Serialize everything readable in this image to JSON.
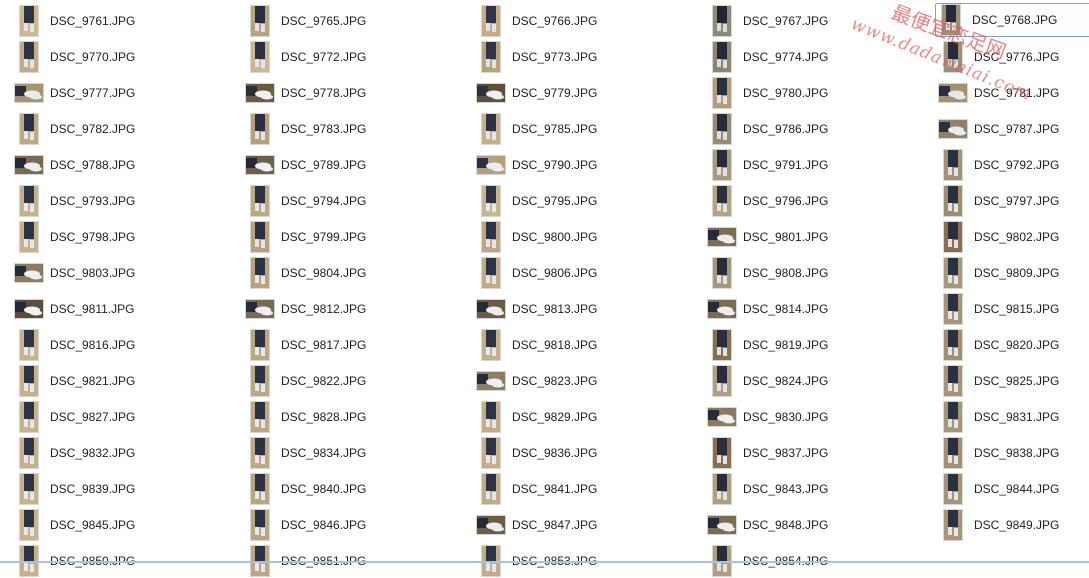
{
  "files": [
    {
      "name": "DSC_9761.JPG",
      "orientation": "portrait",
      "colors": [
        "#ceb78a",
        "#2d3446",
        "#e6e6e6"
      ]
    },
    {
      "name": "DSC_9765.JPG",
      "orientation": "portrait",
      "colors": [
        "#b7a47e",
        "#2a3041",
        "#e2e2e2"
      ]
    },
    {
      "name": "DSC_9766.JPG",
      "orientation": "portrait",
      "colors": [
        "#c7ad80",
        "#30364a",
        "#e4e4e4"
      ]
    },
    {
      "name": "DSC_9767.JPG",
      "orientation": "portrait",
      "colors": [
        "#8f8a78",
        "#202534",
        "#dcdcdc"
      ]
    },
    {
      "name": "DSC_9768.JPG",
      "orientation": "portrait",
      "colors": [
        "#9b8f74",
        "#262b3a",
        "#e0e0e0"
      ]
    },
    {
      "name": "DSC_9770.JPG",
      "orientation": "portrait",
      "colors": [
        "#c4ad85",
        "#2d3446",
        "#e6e6e6"
      ]
    },
    {
      "name": "DSC_9772.JPG",
      "orientation": "portrait",
      "colors": [
        "#cdb690",
        "#2a3142",
        "#e6e6e6"
      ]
    },
    {
      "name": "DSC_9773.JPG",
      "orientation": "portrait",
      "colors": [
        "#b9a27a",
        "#2f3548",
        "#e2e2e2"
      ]
    },
    {
      "name": "DSC_9774.JPG",
      "orientation": "portrait",
      "colors": [
        "#8e8573",
        "#242a38",
        "#dedede"
      ]
    },
    {
      "name": "DSC_9776.JPG",
      "orientation": "portrait",
      "colors": [
        "#9d9178",
        "#252a39",
        "#dedede"
      ]
    },
    {
      "name": "DSC_9777.JPG",
      "orientation": "landscape",
      "colors": [
        "#a69473",
        "#2a3040",
        "#ebebeb"
      ]
    },
    {
      "name": "DSC_9778.JPG",
      "orientation": "landscape",
      "colors": [
        "#6d5b44",
        "#2a2f3c",
        "#f0f0f0"
      ]
    },
    {
      "name": "DSC_9779.JPG",
      "orientation": "landscape",
      "colors": [
        "#5e4f3d",
        "#2c3140",
        "#eeeeee"
      ]
    },
    {
      "name": "DSC_9780.JPG",
      "orientation": "portrait",
      "colors": [
        "#b39d77",
        "#293043",
        "#e4e4e4"
      ]
    },
    {
      "name": "DSC_9781.JPG",
      "orientation": "landscape",
      "colors": [
        "#a2916f",
        "#283042",
        "#e8e8e8"
      ]
    },
    {
      "name": "DSC_9782.JPG",
      "orientation": "portrait",
      "colors": [
        "#c0a982",
        "#2b3244",
        "#e6e6e6"
      ]
    },
    {
      "name": "DSC_9783.JPG",
      "orientation": "portrait",
      "colors": [
        "#b7a07a",
        "#2a3042",
        "#e4e4e4"
      ]
    },
    {
      "name": "DSC_9785.JPG",
      "orientation": "portrait",
      "colors": [
        "#c6b08a",
        "#2c3244",
        "#e6e6e6"
      ]
    },
    {
      "name": "DSC_9786.JPG",
      "orientation": "portrait",
      "colors": [
        "#968b75",
        "#262b3a",
        "#e0e0e0"
      ]
    },
    {
      "name": "DSC_9787.JPG",
      "orientation": "landscape",
      "colors": [
        "#8f826b",
        "#2a3040",
        "#ececec"
      ]
    },
    {
      "name": "DSC_9788.JPG",
      "orientation": "landscape",
      "colors": [
        "#7a6a52",
        "#242937",
        "#eeeeee"
      ]
    },
    {
      "name": "DSC_9789.JPG",
      "orientation": "landscape",
      "colors": [
        "#6f604a",
        "#252a38",
        "#f0f0f0"
      ]
    },
    {
      "name": "DSC_9790.JPG",
      "orientation": "landscape",
      "colors": [
        "#b2a07f",
        "#2a3041",
        "#eeeeee"
      ]
    },
    {
      "name": "DSC_9791.JPG",
      "orientation": "portrait",
      "colors": [
        "#a89a7c",
        "#262c3b",
        "#e2e2e2"
      ]
    },
    {
      "name": "DSC_9792.JPG",
      "orientation": "portrait",
      "colors": [
        "#a49372",
        "#283042",
        "#e4e4e4"
      ]
    },
    {
      "name": "DSC_9793.JPG",
      "orientation": "portrait",
      "colors": [
        "#c7b08a",
        "#2d3446",
        "#e8e8e8"
      ]
    },
    {
      "name": "DSC_9794.JPG",
      "orientation": "portrait",
      "colors": [
        "#bfa880",
        "#2b3244",
        "#e6e6e6"
      ]
    },
    {
      "name": "DSC_9795.JPG",
      "orientation": "portrait",
      "colors": [
        "#cab38d",
        "#2e3447",
        "#e8e8e8"
      ]
    },
    {
      "name": "DSC_9796.JPG",
      "orientation": "portrait",
      "colors": [
        "#b5a481",
        "#2a3042",
        "#e4e4e4"
      ]
    },
    {
      "name": "DSC_9797.JPG",
      "orientation": "portrait",
      "colors": [
        "#9f8e6e",
        "#273042",
        "#e6e6e6"
      ]
    },
    {
      "name": "DSC_9798.JPG",
      "orientation": "portrait",
      "colors": [
        "#c8b28c",
        "#2d3446",
        "#e8e8e8"
      ]
    },
    {
      "name": "DSC_9799.JPG",
      "orientation": "portrait",
      "colors": [
        "#b8a17b",
        "#2b3244",
        "#e6e6e6"
      ]
    },
    {
      "name": "DSC_9800.JPG",
      "orientation": "portrait",
      "colors": [
        "#bfa783",
        "#2c3345",
        "#e6e6e6"
      ]
    },
    {
      "name": "DSC_9801.JPG",
      "orientation": "landscape",
      "colors": [
        "#7d6d55",
        "#262b39",
        "#eeeeee"
      ]
    },
    {
      "name": "DSC_9802.JPG",
      "orientation": "portrait",
      "colors": [
        "#8c6f52",
        "#2a2f3d",
        "#e2e2e2"
      ]
    },
    {
      "name": "DSC_9803.JPG",
      "orientation": "landscape",
      "colors": [
        "#8a7a60",
        "#262b3a",
        "#eeeeee"
      ]
    },
    {
      "name": "DSC_9804.JPG",
      "orientation": "portrait",
      "colors": [
        "#b9a27c",
        "#2b3244",
        "#e8e8e8"
      ]
    },
    {
      "name": "DSC_9806.JPG",
      "orientation": "portrait",
      "colors": [
        "#c3ac86",
        "#2c3345",
        "#e8e8e8"
      ]
    },
    {
      "name": "DSC_9808.JPG",
      "orientation": "portrait",
      "colors": [
        "#a59779",
        "#272d3c",
        "#e4e4e4"
      ]
    },
    {
      "name": "DSC_9809.JPG",
      "orientation": "portrait",
      "colors": [
        "#a99878",
        "#283042",
        "#e6e6e6"
      ]
    },
    {
      "name": "DSC_9811.JPG",
      "orientation": "landscape",
      "colors": [
        "#5b4c3b",
        "#23283a",
        "#f0f0f0"
      ]
    },
    {
      "name": "DSC_9812.JPG",
      "orientation": "landscape",
      "colors": [
        "#7a6a51",
        "#252a38",
        "#eeeeee"
      ]
    },
    {
      "name": "DSC_9813.JPG",
      "orientation": "landscape",
      "colors": [
        "#6b5c46",
        "#262b39",
        "#eeeeee"
      ]
    },
    {
      "name": "DSC_9814.JPG",
      "orientation": "landscape",
      "colors": [
        "#7b6b52",
        "#252a38",
        "#eeeeee"
      ]
    },
    {
      "name": "DSC_9815.JPG",
      "orientation": "portrait",
      "colors": [
        "#a69676",
        "#283042",
        "#e6e6e6"
      ]
    },
    {
      "name": "DSC_9816.JPG",
      "orientation": "portrait",
      "colors": [
        "#c9b38d",
        "#2d3446",
        "#e8e8e8"
      ]
    },
    {
      "name": "DSC_9817.JPG",
      "orientation": "portrait",
      "colors": [
        "#bca680",
        "#2b3244",
        "#e8e8e8"
      ]
    },
    {
      "name": "DSC_9818.JPG",
      "orientation": "portrait",
      "colors": [
        "#c5ae88",
        "#2c3345",
        "#e8e8e8"
      ]
    },
    {
      "name": "DSC_9819.JPG",
      "orientation": "portrait",
      "colors": [
        "#8b6d50",
        "#2a2f3d",
        "#e4e4e4"
      ]
    },
    {
      "name": "DSC_9820.JPG",
      "orientation": "portrait",
      "colors": [
        "#a38f6e",
        "#283042",
        "#e6e6e6"
      ]
    },
    {
      "name": "DSC_9821.JPG",
      "orientation": "portrait",
      "colors": [
        "#c6af89",
        "#2d3446",
        "#e8e8e8"
      ]
    },
    {
      "name": "DSC_9822.JPG",
      "orientation": "portrait",
      "colors": [
        "#bda781",
        "#2b3244",
        "#e8e8e8"
      ]
    },
    {
      "name": "DSC_9823.JPG",
      "orientation": "landscape",
      "colors": [
        "#8d7d62",
        "#262b3a",
        "#eeeeee"
      ]
    },
    {
      "name": "DSC_9824.JPG",
      "orientation": "portrait",
      "colors": [
        "#ad9f80",
        "#272d3c",
        "#e4e4e4"
      ]
    },
    {
      "name": "DSC_9825.JPG",
      "orientation": "portrait",
      "colors": [
        "#a69575",
        "#283042",
        "#e6e6e6"
      ]
    },
    {
      "name": "DSC_9827.JPG",
      "orientation": "portrait",
      "colors": [
        "#c8b18b",
        "#2d3446",
        "#e8e8e8"
      ]
    },
    {
      "name": "DSC_9828.JPG",
      "orientation": "portrait",
      "colors": [
        "#bea882",
        "#2b3244",
        "#e8e8e8"
      ]
    },
    {
      "name": "DSC_9829.JPG",
      "orientation": "portrait",
      "colors": [
        "#c4ad87",
        "#2c3345",
        "#e8e8e8"
      ]
    },
    {
      "name": "DSC_9830.JPG",
      "orientation": "landscape",
      "colors": [
        "#8a7a60",
        "#262b3a",
        "#eeeeee"
      ]
    },
    {
      "name": "DSC_9831.JPG",
      "orientation": "portrait",
      "colors": [
        "#a79676",
        "#283042",
        "#e6e6e6"
      ]
    },
    {
      "name": "DSC_9832.JPG",
      "orientation": "portrait",
      "colors": [
        "#c7b08a",
        "#2d3446",
        "#e8e8e8"
      ]
    },
    {
      "name": "DSC_9834.JPG",
      "orientation": "portrait",
      "colors": [
        "#bfa983",
        "#2b3244",
        "#e8e8e8"
      ]
    },
    {
      "name": "DSC_9836.JPG",
      "orientation": "portrait",
      "colors": [
        "#c5ae88",
        "#2c3345",
        "#e8e8e8"
      ]
    },
    {
      "name": "DSC_9837.JPG",
      "orientation": "portrait",
      "colors": [
        "#8c6e51",
        "#2a2f3d",
        "#e4e4e4"
      ]
    },
    {
      "name": "DSC_9838.JPG",
      "orientation": "portrait",
      "colors": [
        "#a48f6f",
        "#283042",
        "#e6e6e6"
      ]
    },
    {
      "name": "DSC_9839.JPG",
      "orientation": "portrait",
      "colors": [
        "#c8b18b",
        "#2d3446",
        "#e8e8e8"
      ]
    },
    {
      "name": "DSC_9840.JPG",
      "orientation": "portrait",
      "colors": [
        "#bba57f",
        "#2b3244",
        "#e8e8e8"
      ]
    },
    {
      "name": "DSC_9841.JPG",
      "orientation": "portrait",
      "colors": [
        "#c3ac86",
        "#2c3345",
        "#e8e8e8"
      ]
    },
    {
      "name": "DSC_9843.JPG",
      "orientation": "portrait",
      "colors": [
        "#ae9f80",
        "#272d3c",
        "#e4e4e4"
      ]
    },
    {
      "name": "DSC_9844.JPG",
      "orientation": "portrait",
      "colors": [
        "#a59575",
        "#283042",
        "#e6e6e6"
      ]
    },
    {
      "name": "DSC_9845.JPG",
      "orientation": "portrait",
      "colors": [
        "#c9b28c",
        "#2d3446",
        "#e8e8e8"
      ]
    },
    {
      "name": "DSC_9846.JPG",
      "orientation": "portrait",
      "colors": [
        "#bca680",
        "#2b3244",
        "#e8e8e8"
      ]
    },
    {
      "name": "DSC_9847.JPG",
      "orientation": "landscape",
      "colors": [
        "#6c5d47",
        "#262b39",
        "#eeeeee"
      ]
    },
    {
      "name": "DSC_9848.JPG",
      "orientation": "landscape",
      "colors": [
        "#7c6c53",
        "#252a38",
        "#eeeeee"
      ]
    },
    {
      "name": "DSC_9849.JPG",
      "orientation": "portrait",
      "colors": [
        "#a69676",
        "#283042",
        "#e6e6e6"
      ]
    },
    {
      "name": "DSC_9850.JPG",
      "orientation": "portrait",
      "colors": [
        "#c7b08a",
        "#2d3446",
        "#e8e8e8"
      ]
    },
    {
      "name": "DSC_9851.JPG",
      "orientation": "portrait",
      "colors": [
        "#bda781",
        "#2b3244",
        "#e8e8e8"
      ]
    },
    {
      "name": "DSC_9853.JPG",
      "orientation": "portrait",
      "colors": [
        "#c4ad87",
        "#2c3345",
        "#e8e8e8"
      ]
    },
    {
      "name": "DSC_9854.JPG",
      "orientation": "portrait",
      "colors": [
        "#ae9f80",
        "#272d3c",
        "#e4e4e4"
      ]
    }
  ],
  "selected_file": "DSC_9768.JPG",
  "watermark": {
    "line1": "最便宜恋足网",
    "line2": "www.dadawaiai.com",
    "color": "#e05a5a",
    "color_alt": "#5a6ee0"
  },
  "colors": {
    "selection_border": "#7da2ce",
    "text": "#1e1e1e",
    "scroll_strip": "#a9c2dd"
  }
}
